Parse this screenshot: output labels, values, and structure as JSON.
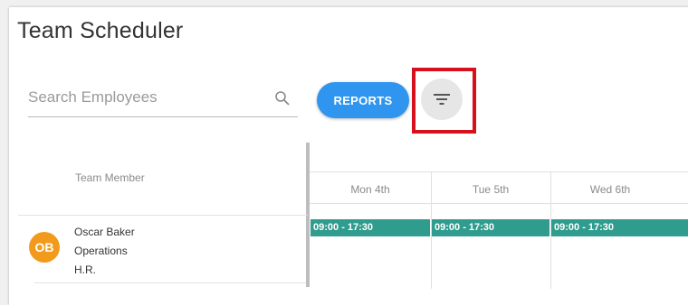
{
  "app": {
    "title": "Team Scheduler"
  },
  "search": {
    "placeholder": "Search Employees"
  },
  "toolbar": {
    "reports_label": "REPORTS"
  },
  "table": {
    "member_header": "Team Member",
    "days": [
      "Mon 4th",
      "Tue 5th",
      "Wed 6th"
    ],
    "employees": [
      {
        "initials": "OB",
        "name": "Oscar Baker",
        "department": "Operations",
        "team": "H.R.",
        "shifts": [
          "09:00 - 17:30",
          "09:00 - 17:30",
          "09:00 - 17:30"
        ]
      }
    ]
  },
  "colors": {
    "accent": "#2f95ee",
    "shift": "#2f9c8e",
    "avatar": "#f29a1c",
    "highlight": "#d6111d"
  },
  "icons": {
    "search": "search-icon",
    "filter": "filter-icon"
  }
}
